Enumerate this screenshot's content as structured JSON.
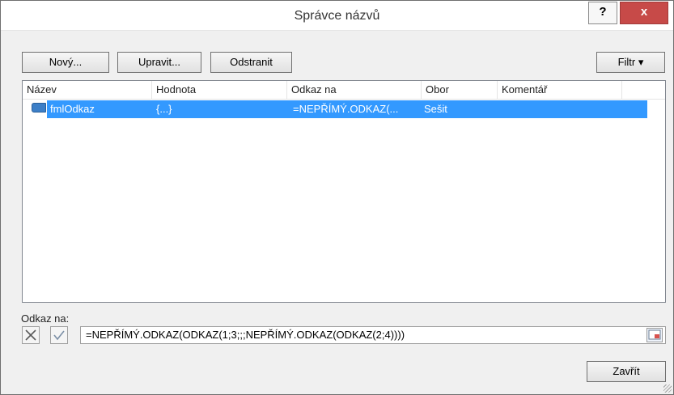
{
  "window": {
    "title": "Správce názvů",
    "help": "?",
    "close": "x"
  },
  "toolbar": {
    "new_label": "Nový...",
    "edit_label": "Upravit...",
    "delete_label": "Odstranit",
    "filter_label": "Filtr ▾"
  },
  "list": {
    "columns": [
      "Název",
      "Hodnota",
      "Odkaz na",
      "Obor",
      "Komentář"
    ],
    "rows": [
      {
        "name": "fmlOdkaz",
        "value": "{...}",
        "ref": "=NEPŘÍMÝ.ODKAZ(...",
        "scope": "Sešit",
        "comment": ""
      }
    ]
  },
  "reference": {
    "label": "Odkaz na:",
    "value": "=NEPŘÍMÝ.ODKAZ(ODKAZ(1;3;;;NEPŘÍMÝ.ODKAZ(ODKAZ(2;4))))"
  },
  "footer": {
    "close_label": "Zavřít"
  },
  "colors": {
    "selection": "#3399ff",
    "close_button": "#c74a48"
  }
}
